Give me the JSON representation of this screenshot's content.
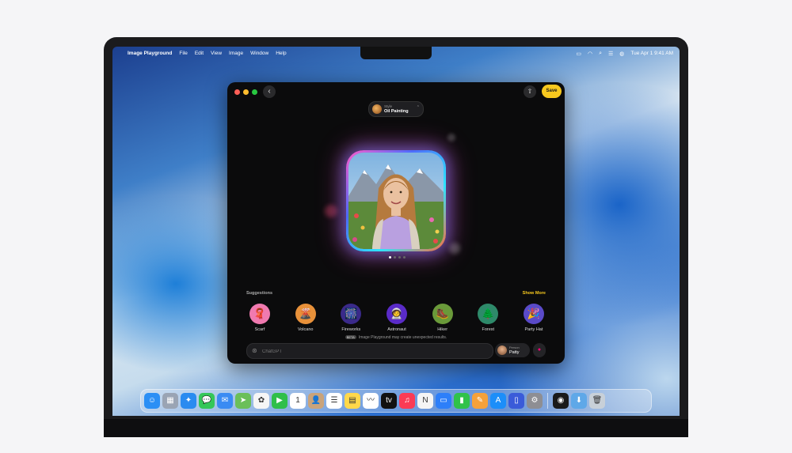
{
  "menubar": {
    "apple": "",
    "app_name": "Image Playground",
    "menus": [
      "File",
      "Edit",
      "View",
      "Image",
      "Window",
      "Help"
    ],
    "datetime": "Tue Apr 1  9:41 AM"
  },
  "window": {
    "save_label": "Save",
    "style_label": "Style",
    "style_value": "Oil Painting",
    "suggestions_title": "Suggestions",
    "show_more": "Show More",
    "suggestions": [
      {
        "label": "Scarf",
        "icon": "scarf-icon",
        "glyph": "🧣",
        "color": "#f07ab0"
      },
      {
        "label": "Volcano",
        "icon": "volcano-icon",
        "glyph": "🌋",
        "color": "#e8913a"
      },
      {
        "label": "Fireworks",
        "icon": "fireworks-icon",
        "glyph": "🎆",
        "color": "#3a2a8a"
      },
      {
        "label": "Astronaut",
        "icon": "astronaut-icon",
        "glyph": "🧑‍🚀",
        "color": "#5a2bc8"
      },
      {
        "label": "Hiker",
        "icon": "hiker-icon",
        "glyph": "🥾",
        "color": "#6a9a3a"
      },
      {
        "label": "Forest",
        "icon": "forest-icon",
        "glyph": "🌲",
        "color": "#2e8a6a"
      },
      {
        "label": "Party Hat",
        "icon": "party-hat-icon",
        "glyph": "🎉",
        "color": "#5a4ac8"
      }
    ],
    "notice_tag": "BETA",
    "notice": "Image Playground may create unexpected results.",
    "prompt_placeholder": "ChatGPT",
    "person_label": "Person",
    "person_name": "Patty",
    "page_dots": 4,
    "active_dot": 0
  },
  "dock": {
    "apps": [
      {
        "name": "finder-icon",
        "glyph": "☺",
        "color": "#2b8ff5"
      },
      {
        "name": "launchpad-icon",
        "glyph": "▦",
        "color": "#9aa4b4"
      },
      {
        "name": "safari-icon",
        "glyph": "✦",
        "color": "#2a8bf0"
      },
      {
        "name": "messages-icon",
        "glyph": "💬",
        "color": "#34c759"
      },
      {
        "name": "mail-icon",
        "glyph": "✉",
        "color": "#3a8bf3"
      },
      {
        "name": "maps-icon",
        "glyph": "➤",
        "color": "#6bbf59"
      },
      {
        "name": "photos-icon",
        "glyph": "✿",
        "color": "#f6f6f6"
      },
      {
        "name": "facetime-icon",
        "glyph": "▶",
        "color": "#2fbf4a"
      },
      {
        "name": "calendar-icon",
        "glyph": "1",
        "color": "#ffffff"
      },
      {
        "name": "contacts-icon",
        "glyph": "👤",
        "color": "#c9a37a"
      },
      {
        "name": "reminders-icon",
        "glyph": "☰",
        "color": "#ffffff"
      },
      {
        "name": "notes-icon",
        "glyph": "▤",
        "color": "#ffd84a"
      },
      {
        "name": "freeform-icon",
        "glyph": "〰",
        "color": "#ffffff"
      },
      {
        "name": "appletv-icon",
        "glyph": "tv",
        "color": "#111111"
      },
      {
        "name": "music-icon",
        "glyph": "♫",
        "color": "#fa3b55"
      },
      {
        "name": "news-icon",
        "glyph": "N",
        "color": "#f5f5f5"
      },
      {
        "name": "keynote-icon",
        "glyph": "▭",
        "color": "#2d7ff9"
      },
      {
        "name": "numbers-icon",
        "glyph": "▮",
        "color": "#30c24a"
      },
      {
        "name": "pages-icon",
        "glyph": "✎",
        "color": "#f6a13a"
      },
      {
        "name": "appstore-icon",
        "glyph": "A",
        "color": "#1c8ef9"
      },
      {
        "name": "iphone-mirroring-icon",
        "glyph": "▯",
        "color": "#3a5bd9"
      },
      {
        "name": "system-settings-icon",
        "glyph": "⚙",
        "color": "#8e8e93"
      },
      {
        "name": "image-playground-icon",
        "glyph": "◉",
        "color": "#1a1a1a"
      },
      {
        "name": "downloads-folder-icon",
        "glyph": "⬇",
        "color": "#5fa8e8"
      },
      {
        "name": "trash-icon",
        "glyph": "🗑",
        "color": "#c8d0d8"
      }
    ]
  }
}
